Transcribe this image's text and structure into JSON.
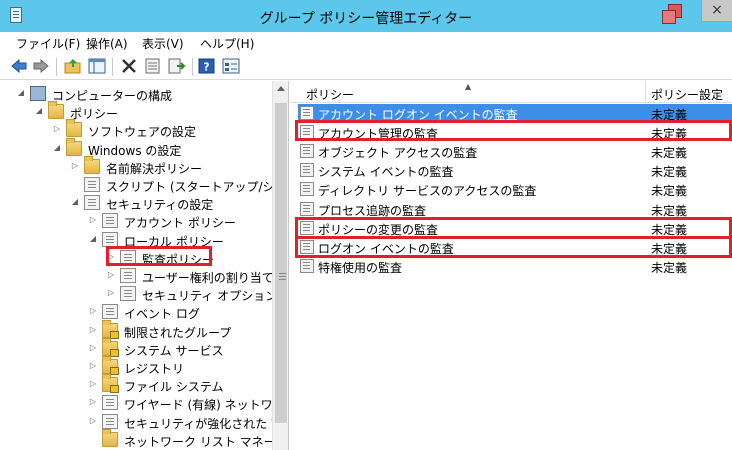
{
  "window": {
    "title": "グループ ポリシー管理エディター",
    "close_glyph": "×"
  },
  "menu": [
    "ファイル(F)",
    "操作(A)",
    "表示(V)",
    "ヘルプ(H)"
  ],
  "toolbar": {
    "icons": [
      "back-arrow-icon",
      "forward-arrow-icon",
      "up-folder-icon",
      "show-hide-tree-icon",
      "delete-icon",
      "properties-icon",
      "export-list-icon",
      "help-icon",
      "view-icon"
    ]
  },
  "tree": [
    {
      "label": "コンピューターの構成",
      "level": 0,
      "expander": "◢",
      "icon": "computer-icon"
    },
    {
      "label": "ポリシー",
      "level": 1,
      "expander": "◢",
      "icon": "folder-icon"
    },
    {
      "label": "ソフトウェアの設定",
      "level": 2,
      "expander": "▷",
      "icon": "folder-icon"
    },
    {
      "label": "Windows の設定",
      "level": 2,
      "expander": "◢",
      "icon": "folder-icon"
    },
    {
      "label": "名前解決ポリシー",
      "level": 3,
      "expander": "▷",
      "icon": "folder-icon"
    },
    {
      "label": "スクリプト (スタートアップ/シャットダウ",
      "level": 3,
      "expander": "",
      "icon": "script-icon"
    },
    {
      "label": "セキュリティの設定",
      "level": 3,
      "expander": "◢",
      "icon": "security-icon"
    },
    {
      "label": "アカウント ポリシー",
      "level": 4,
      "expander": "▷",
      "icon": "policy-icon"
    },
    {
      "label": "ローカル ポリシー",
      "level": 4,
      "expander": "◢",
      "icon": "policy-icon"
    },
    {
      "label": "監査ポリシー",
      "level": 5,
      "expander": "▷",
      "icon": "policy-icon"
    },
    {
      "label": "ユーザー権利の割り当て",
      "level": 5,
      "expander": "▷",
      "icon": "policy-icon"
    },
    {
      "label": "セキュリティ オプション",
      "level": 5,
      "expander": "▷",
      "icon": "policy-icon"
    },
    {
      "label": "イベント ログ",
      "level": 4,
      "expander": "▷",
      "icon": "policy-icon"
    },
    {
      "label": "制限されたグループ",
      "level": 4,
      "expander": "▷",
      "icon": "locked-folder-icon"
    },
    {
      "label": "システム サービス",
      "level": 4,
      "expander": "▷",
      "icon": "locked-folder-icon"
    },
    {
      "label": "レジストリ",
      "level": 4,
      "expander": "▷",
      "icon": "locked-folder-icon"
    },
    {
      "label": "ファイル システム",
      "level": 4,
      "expander": "▷",
      "icon": "locked-folder-icon"
    },
    {
      "label": "ワイヤード (有線) ネットワーク",
      "level": 4,
      "expander": "▷",
      "icon": "network-icon"
    },
    {
      "label": "セキュリティが強化された Wind",
      "level": 4,
      "expander": "▷",
      "icon": "firewall-icon"
    },
    {
      "label": "ネットワーク リスト マネージャー",
      "level": 4,
      "expander": "",
      "icon": "folder-icon"
    }
  ],
  "list": {
    "columns": [
      "ポリシー",
      "ポリシー設定"
    ],
    "sort_glyph": "▲",
    "rows": [
      {
        "name": "アカウント ログオン イベントの監査",
        "setting": "未定義",
        "selected": true
      },
      {
        "name": "アカウント管理の監査",
        "setting": "未定義",
        "selected": false
      },
      {
        "name": "オブジェクト アクセスの監査",
        "setting": "未定義",
        "selected": false
      },
      {
        "name": "システム イベントの監査",
        "setting": "未定義",
        "selected": false
      },
      {
        "name": "ディレクトリ サービスのアクセスの監査",
        "setting": "未定義",
        "selected": false
      },
      {
        "name": "プロセス追跡の監査",
        "setting": "未定義",
        "selected": false
      },
      {
        "name": "ポリシーの変更の監査",
        "setting": "未定義",
        "selected": false
      },
      {
        "name": "ログオン イベントの監査",
        "setting": "未定義",
        "selected": false
      },
      {
        "name": "特権使用の監査",
        "setting": "未定義",
        "selected": false
      }
    ]
  },
  "colors": {
    "titlebar": "#5cc7ea",
    "selection": "#3d8ee6",
    "highlight_box": "#e0202a"
  }
}
